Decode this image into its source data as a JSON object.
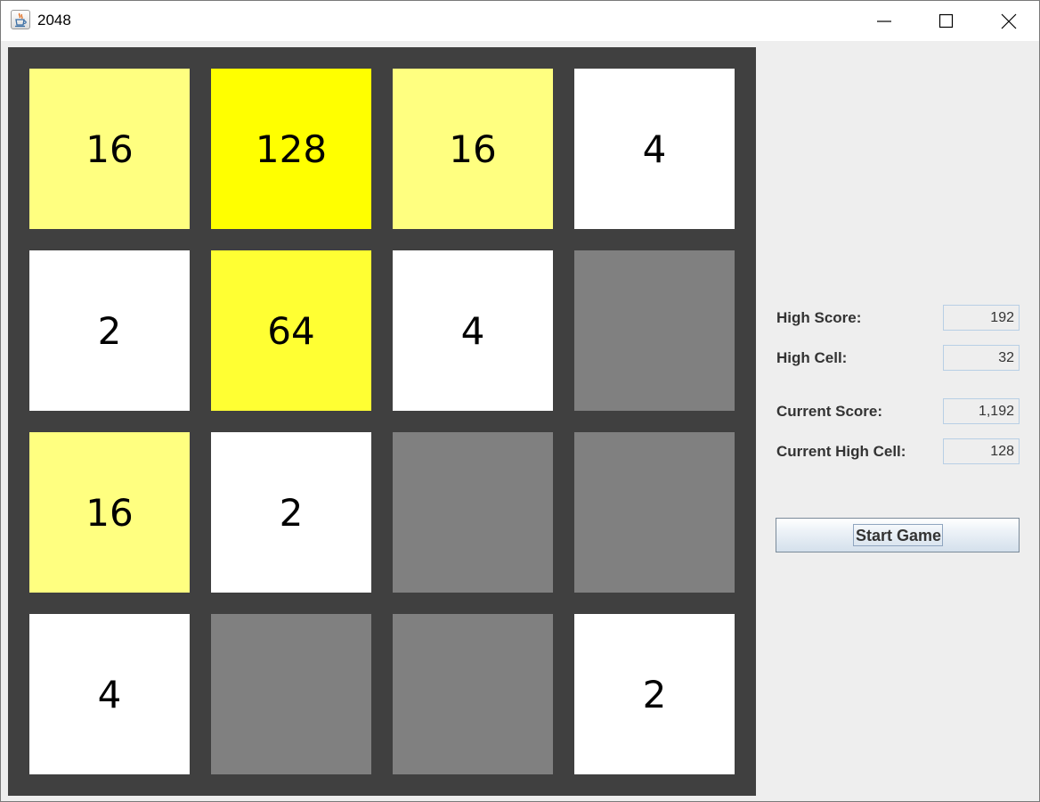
{
  "window": {
    "title": "2048",
    "icon": "java-cup-icon",
    "controls": [
      "minimize-icon",
      "maximize-icon",
      "close-icon"
    ]
  },
  "board": {
    "rows": 4,
    "cols": 4,
    "cells": [
      [
        "16",
        "128",
        "16",
        "4"
      ],
      [
        "2",
        "64",
        "4",
        ""
      ],
      [
        "16",
        "2",
        "",
        ""
      ],
      [
        "4",
        "",
        "",
        "2"
      ]
    ],
    "colors": {
      "empty": "#808080",
      "2": "#ffffff",
      "4": "#ffffff",
      "16": "#ffff80",
      "64": "#ffff33",
      "128": "#ffff00",
      "board": "#404040"
    }
  },
  "stats": {
    "high_score_label": "High Score:",
    "high_score": "192",
    "high_cell_label": "High Cell:",
    "high_cell": "32",
    "current_score_label": "Current Score:",
    "current_score": "1,192",
    "current_high_cell_label": "Current High Cell:",
    "current_high_cell": "128"
  },
  "controls": {
    "start_label": "Start Game"
  }
}
